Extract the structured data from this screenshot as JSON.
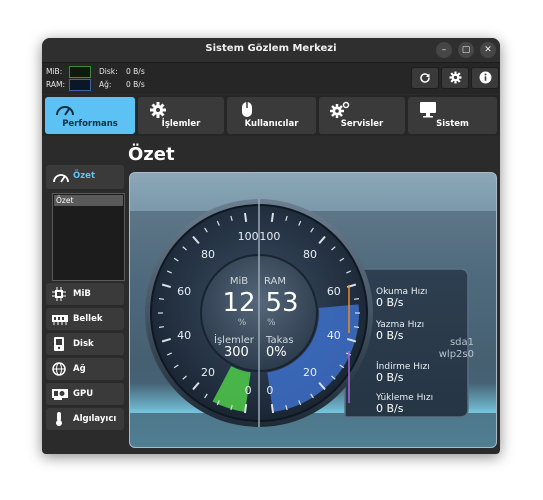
{
  "window": {
    "title": "Sistem Gözlem Merkezi",
    "controls": {
      "minimize": "–",
      "maximize": "▢",
      "close": "✕"
    }
  },
  "top_info": {
    "mib_label": "MiB:",
    "ram_label": "RAM:",
    "disk_label": "Disk:",
    "disk_value": "0 B/s",
    "net_label": "Ağ:",
    "net_value": "0 B/s"
  },
  "toolbar": {
    "refresh_icon": "refresh-icon",
    "settings_icon": "gear-icon",
    "about_icon": "info-icon"
  },
  "tabs": [
    {
      "label": "Performans",
      "icon": "speedometer-icon",
      "active": true
    },
    {
      "label": "İşlemler",
      "icon": "gear-icon",
      "active": false
    },
    {
      "label": "Kullanıcılar",
      "icon": "mouse-icon",
      "active": false
    },
    {
      "label": "Servisler",
      "icon": "gears-icon",
      "active": false
    },
    {
      "label": "Sistem",
      "icon": "monitor-icon",
      "active": false
    }
  ],
  "sidebar": {
    "summary_label": "Özet",
    "list_items": [
      "Özet"
    ],
    "items": [
      {
        "label": "MiB",
        "icon": "cpu-icon"
      },
      {
        "label": "Bellek",
        "icon": "ram-icon"
      },
      {
        "label": "Disk",
        "icon": "disk-icon"
      },
      {
        "label": "Ağ",
        "icon": "globe-icon"
      },
      {
        "label": "GPU",
        "icon": "gpu-icon"
      },
      {
        "label": "Algılayıcı",
        "icon": "thermometer-icon"
      }
    ]
  },
  "page_title": "Özet",
  "gauge": {
    "left": {
      "label": "MiB",
      "value": "12",
      "unit": "%",
      "percent": 12,
      "ticks": [
        "0",
        "20",
        "40",
        "60",
        "80",
        "100"
      ],
      "sub_label": "İşlemler",
      "sub_value": "300"
    },
    "right": {
      "label": "RAM",
      "value": "53",
      "unit": "%",
      "percent": 53,
      "ticks": [
        "0",
        "20",
        "40",
        "60",
        "80",
        "100"
      ],
      "sub_label": "Takas",
      "sub_value": "0%"
    }
  },
  "disk_net": {
    "read_label": "Okuma Hızı",
    "read_value": "0 B/s",
    "write_label": "Yazma Hızı",
    "write_value": "0 B/s",
    "disk_device": "sda1",
    "down_label": "İndirme Hızı",
    "down_value": "0 B/s",
    "up_label": "Yükleme Hızı",
    "up_value": "0 B/s",
    "net_device": "wlp2s0"
  },
  "colors": {
    "accent": "#5bc2f3",
    "cpu_fill": "#4dc34a",
    "ram_fill": "#3d6ec9",
    "read_line": "#e88b2a",
    "write_line": "#a06bd6"
  }
}
